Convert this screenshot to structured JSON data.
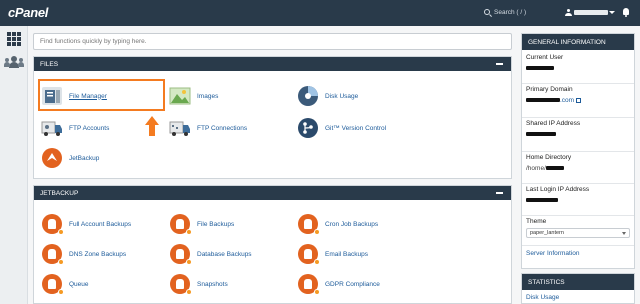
{
  "app": {
    "logo": "cPanel"
  },
  "topbar": {
    "search_label": "Search ( / )"
  },
  "search": {
    "placeholder": "Find functions quickly by typing here."
  },
  "files_panel": {
    "title": "FILES",
    "items": [
      {
        "label": "File Manager"
      },
      {
        "label": "Images"
      },
      {
        "label": "Disk Usage"
      },
      {
        "label": "FTP Accounts"
      },
      {
        "label": "FTP Connections"
      },
      {
        "label": "Git™ Version Control"
      },
      {
        "label": "JetBackup"
      }
    ]
  },
  "jetbackup_panel": {
    "title": "JETBACKUP",
    "items": [
      {
        "label": "Full Account Backups"
      },
      {
        "label": "File Backups"
      },
      {
        "label": "Cron Job Backups"
      },
      {
        "label": "DNS Zone Backups"
      },
      {
        "label": "Database Backups"
      },
      {
        "label": "Email Backups"
      },
      {
        "label": "Queue"
      },
      {
        "label": "Snapshots"
      },
      {
        "label": "GDPR Compliance"
      }
    ]
  },
  "general_info": {
    "title": "GENERAL INFORMATION",
    "current_user_label": "Current User",
    "primary_domain_label": "Primary Domain",
    "primary_domain_suffix": ".com",
    "shared_ip_label": "Shared IP Address",
    "home_dir_label": "Home Directory",
    "home_dir_value": "/home/",
    "last_login_label": "Last Login IP Address",
    "theme_label": "Theme",
    "theme_value": "paper_lantern",
    "server_info_link": "Server Information"
  },
  "statistics": {
    "title": "STATISTICS",
    "first_link": "Disk Usage"
  },
  "colors": {
    "topbar": "#293a4a",
    "accent_highlight": "#f47b20",
    "link": "#1d5b9a",
    "jetbackup_orange": "#e2621f"
  }
}
